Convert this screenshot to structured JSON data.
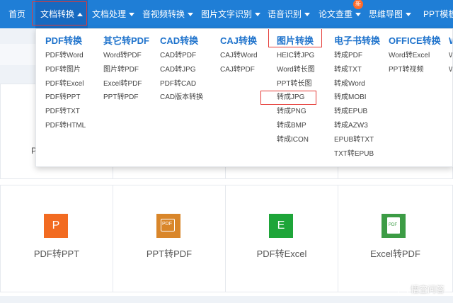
{
  "nav": {
    "items": [
      {
        "label": "首页",
        "arrow": false
      },
      {
        "label": "文档转换",
        "arrow": true
      },
      {
        "label": "文档处理",
        "arrow": true
      },
      {
        "label": "音视频转换",
        "arrow": true
      },
      {
        "label": "图片文字识别",
        "arrow": true
      },
      {
        "label": "语音识别",
        "arrow": true
      },
      {
        "label": "论文查重",
        "arrow": true
      },
      {
        "label": "思维导图",
        "arrow": true
      },
      {
        "label": "PPT模板",
        "arrow": false
      }
    ],
    "badge": "新"
  },
  "menu": {
    "columns": [
      {
        "title": "PDF转换",
        "items": [
          "PDF转Word",
          "PDF转图片",
          "PDF转Excel",
          "PDF转PPT",
          "PDF转TXT",
          "PDF转HTML"
        ]
      },
      {
        "title": "其它转PDF",
        "items": [
          "Word转PDF",
          "图片转PDF",
          "Excel转PDF",
          "PPT转PDF"
        ]
      },
      {
        "title": "CAD转换",
        "items": [
          "CAD转PDF",
          "CAD转JPG",
          "PDF转CAD",
          "CAD版本转换"
        ]
      },
      {
        "title": "CAJ转换",
        "items": [
          "CAJ转Word",
          "CAJ转PDF"
        ]
      },
      {
        "title": "图片转换",
        "items": [
          "HEIC转JPG",
          "Word转长图",
          "PPT转长图",
          "转成JPG",
          "转成PNG",
          "转成BMP",
          "转成ICON"
        ]
      },
      {
        "title": "电子书转换",
        "items": [
          "转成PDF",
          "转成TXT",
          "转成Word",
          "转成MOBI",
          "转成EPUB",
          "转成AZW3",
          "EPUB转TXT",
          "TXT转EPUB"
        ]
      },
      {
        "title": "OFFICE转换",
        "items": [
          "Word转Excel",
          "PPT转视频"
        ]
      },
      {
        "title": "W",
        "items": [
          "W",
          "W"
        ]
      }
    ]
  },
  "cards": [
    {
      "label": "PDF转PPT",
      "icon": "P",
      "icon_name": "ppt-file-icon",
      "color": "#f26b21"
    },
    {
      "label": "PPT转PDF",
      "icon": "PDF",
      "icon_name": "pdf-file-icon",
      "color": "#d9862a"
    },
    {
      "label": "PDF转Excel",
      "icon": "E",
      "icon_name": "excel-file-icon",
      "color": "#1ea539"
    },
    {
      "label": "Excel转PDF",
      "icon": "PDF",
      "icon_name": "pdf-file-icon",
      "color": "#3c9c45"
    }
  ],
  "partial_card_text": "P",
  "watermark": "悟空问答"
}
